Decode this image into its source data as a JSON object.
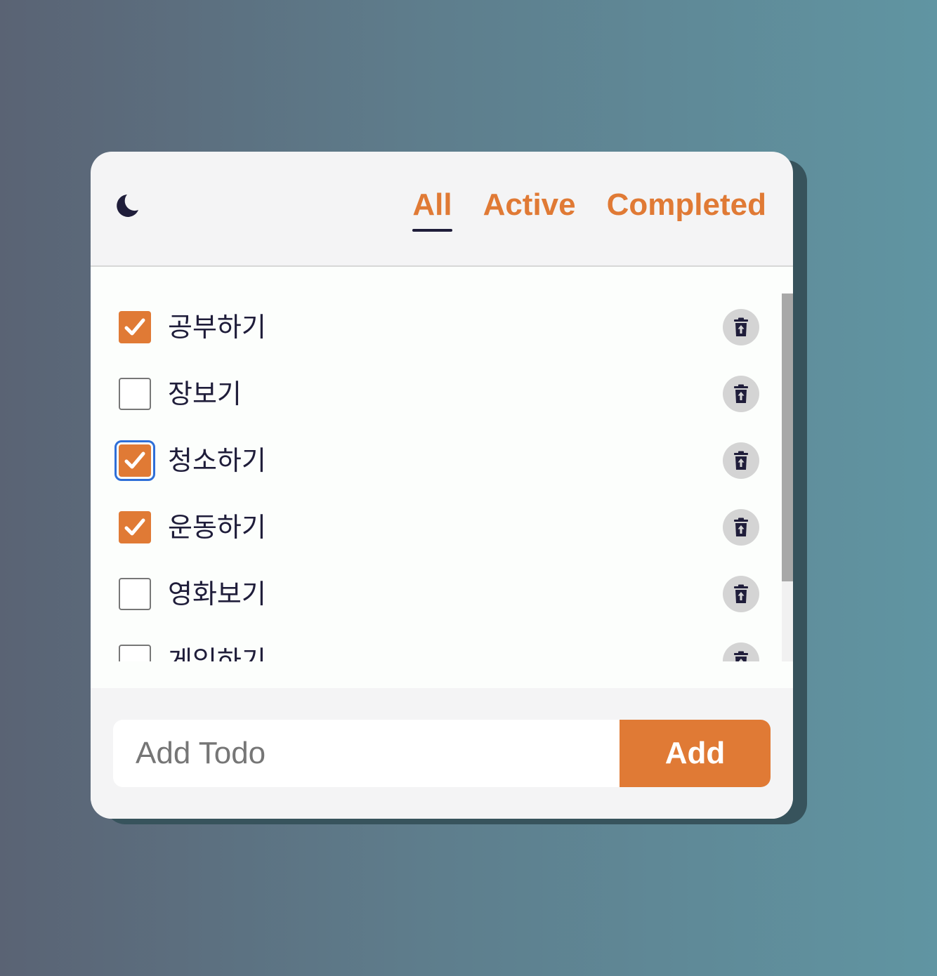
{
  "theme_toggle": {
    "icon": "moon-icon"
  },
  "filters": [
    {
      "label": "All",
      "active": true
    },
    {
      "label": "Active",
      "active": false
    },
    {
      "label": "Completed",
      "active": false
    }
  ],
  "todos": [
    {
      "text": "공부하기",
      "completed": true
    },
    {
      "text": "장보기",
      "completed": false
    },
    {
      "text": "청소하기",
      "completed": true
    },
    {
      "text": "운동하기",
      "completed": true
    },
    {
      "text": "영화보기",
      "completed": false
    },
    {
      "text": "게임하기",
      "completed": false
    }
  ],
  "add_form": {
    "placeholder": "Add Todo",
    "value": "",
    "button_label": "Add"
  },
  "colors": {
    "accent": "#e07a35",
    "text_dark": "#1f1d3a",
    "focus": "#2f6fd8"
  }
}
